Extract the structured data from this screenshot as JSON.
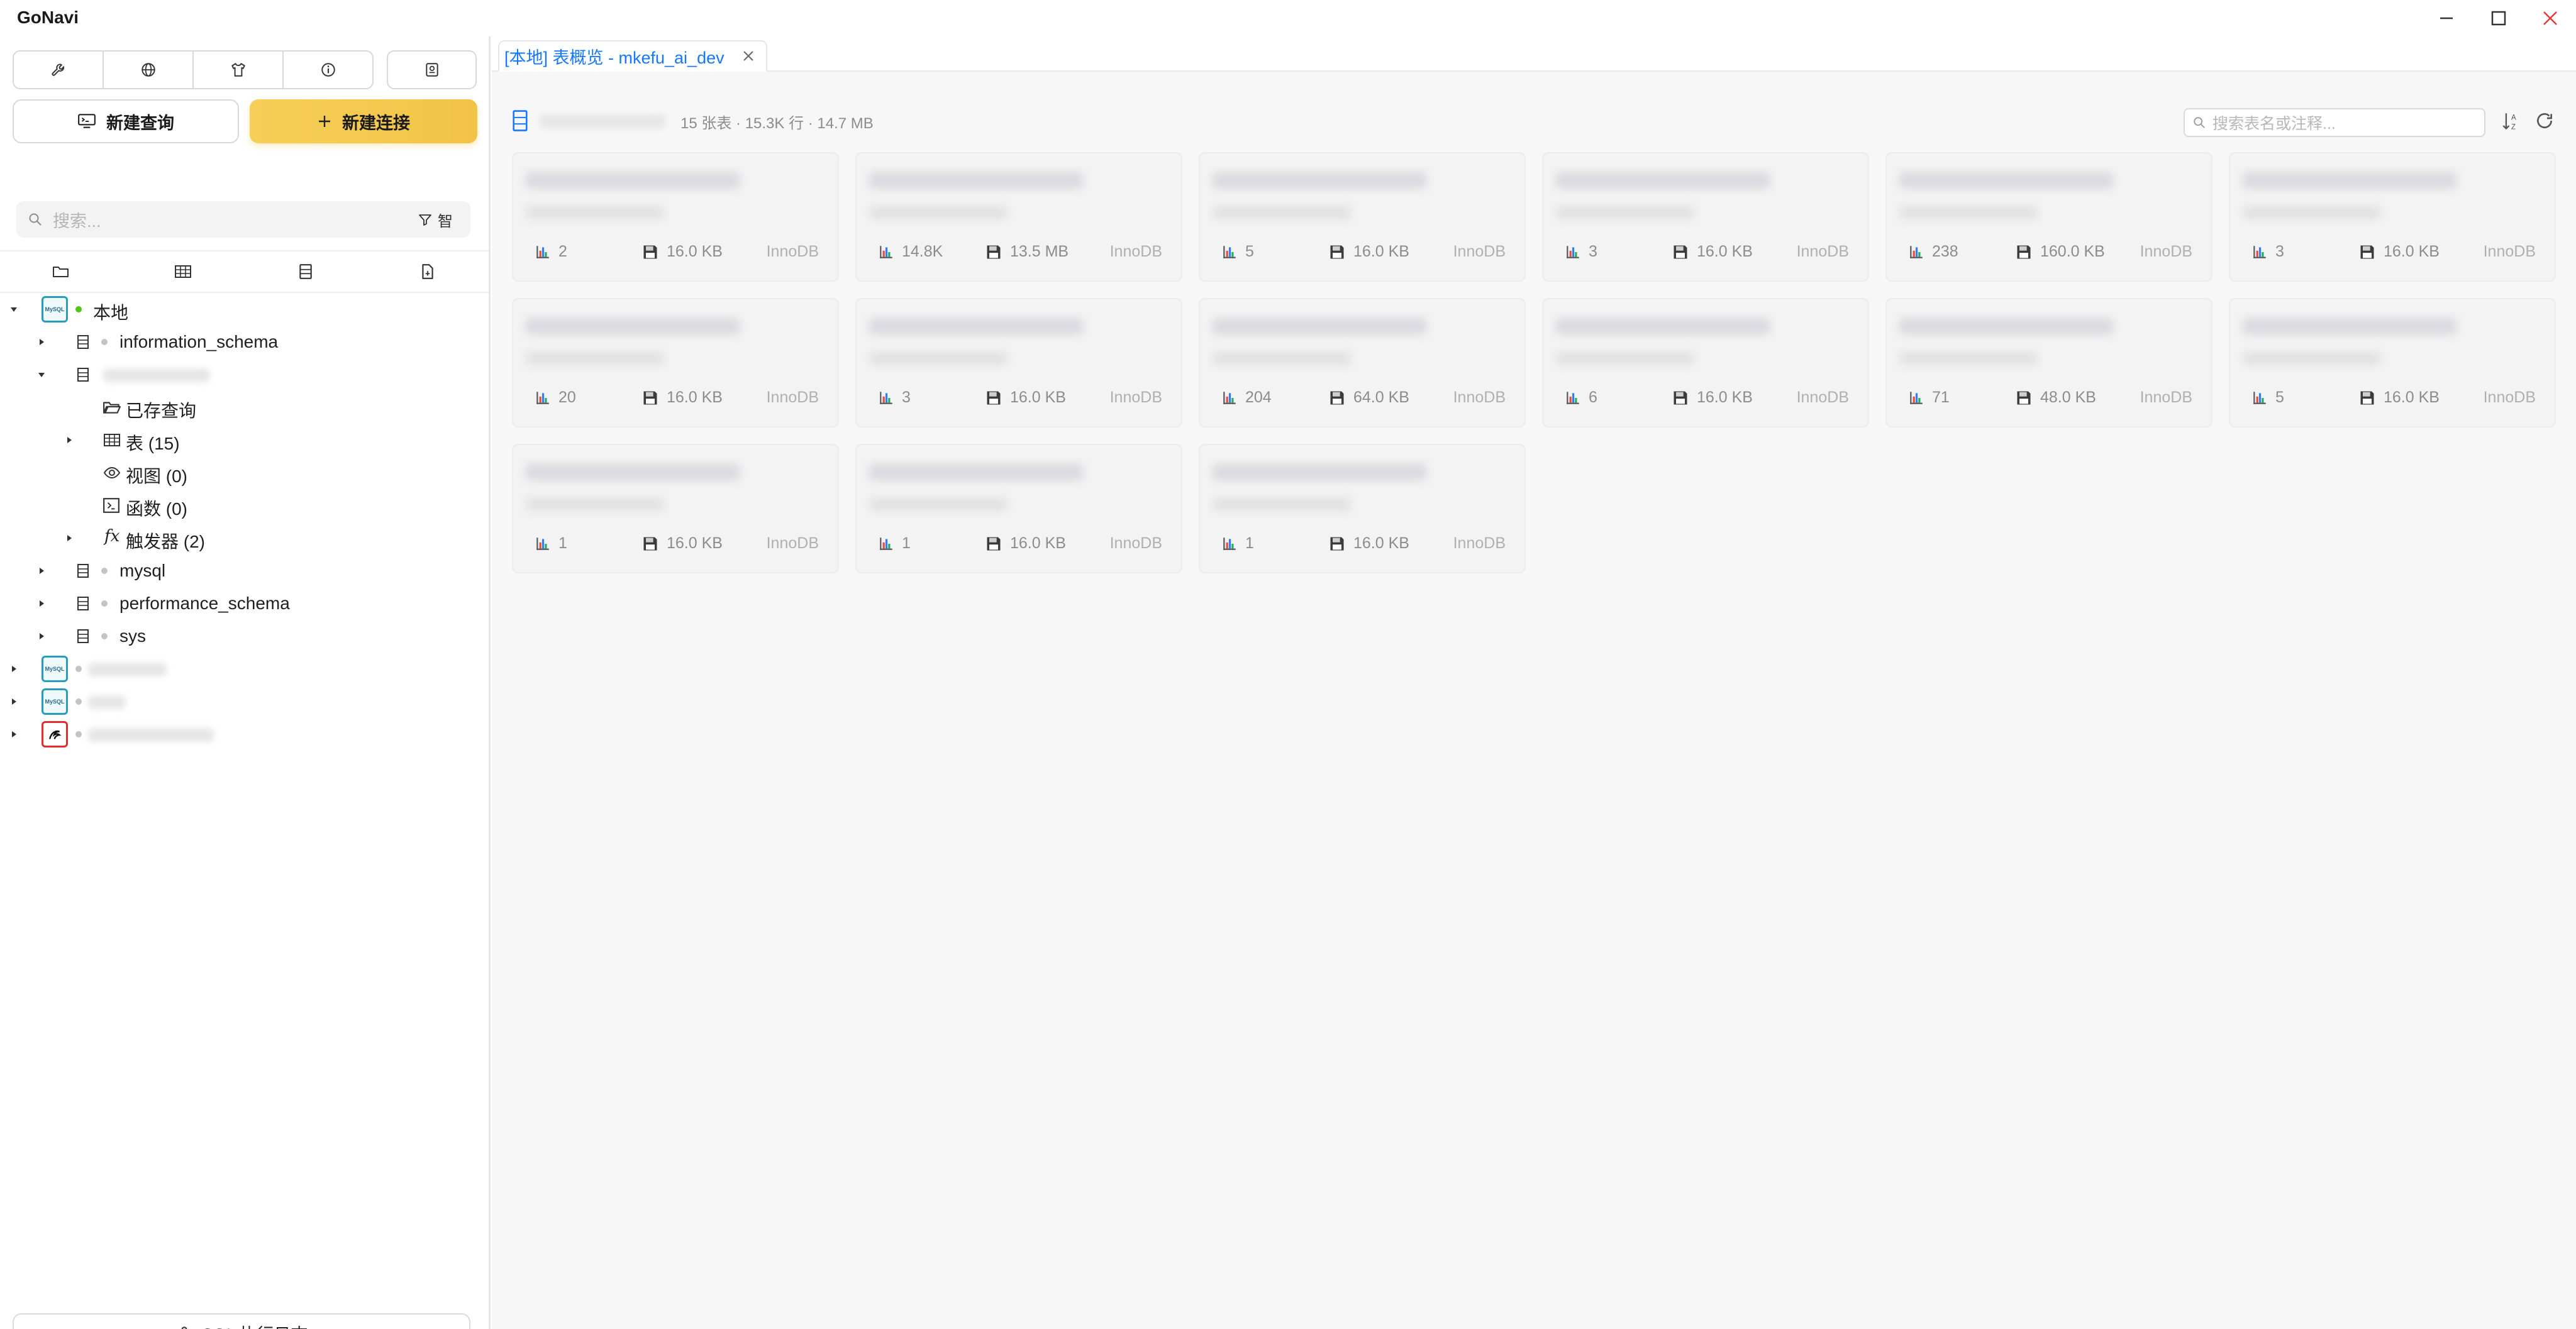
{
  "window": {
    "title": "GoNavi"
  },
  "sidebar": {
    "toolbar_icons": [
      "wrench-icon",
      "globe-icon",
      "shirt-icon",
      "info-icon",
      "contact-icon"
    ],
    "new_query_label": "新建查询",
    "new_connection_label": "新建连接",
    "search_placeholder": "搜索...",
    "filter_label": "智",
    "tab_icons": [
      "folder-icon",
      "table-icon",
      "database-icon",
      "file-icon"
    ],
    "tree": {
      "local_label": "本地",
      "db_information_schema": "information_schema",
      "saved_queries": "已存查询",
      "tables": "表 (15)",
      "views": "视图 (0)",
      "functions": "函数 (0)",
      "triggers": "触发器 (2)",
      "db_mysql": "mysql",
      "db_performance_schema": "performance_schema",
      "db_sys": "sys"
    },
    "sql_log_label": "SQL 执行日志"
  },
  "tab": {
    "label": "[本地] 表概览 - mkefu_ai_dev"
  },
  "overview": {
    "stats": "15 张表 · 15.3K 行 · 14.7 MB",
    "search_placeholder": "搜索表名或注释...",
    "cards": [
      {
        "rows": "2",
        "size": "16.0 KB",
        "engine": "InnoDB"
      },
      {
        "rows": "14.8K",
        "size": "13.5 MB",
        "engine": "InnoDB"
      },
      {
        "rows": "5",
        "size": "16.0 KB",
        "engine": "InnoDB"
      },
      {
        "rows": "3",
        "size": "16.0 KB",
        "engine": "InnoDB"
      },
      {
        "rows": "238",
        "size": "160.0 KB",
        "engine": "InnoDB"
      },
      {
        "rows": "3",
        "size": "16.0 KB",
        "engine": "InnoDB"
      },
      {
        "rows": "20",
        "size": "16.0 KB",
        "engine": "InnoDB"
      },
      {
        "rows": "3",
        "size": "16.0 KB",
        "engine": "InnoDB"
      },
      {
        "rows": "204",
        "size": "64.0 KB",
        "engine": "InnoDB"
      },
      {
        "rows": "6",
        "size": "16.0 KB",
        "engine": "InnoDB"
      },
      {
        "rows": "71",
        "size": "48.0 KB",
        "engine": "InnoDB"
      },
      {
        "rows": "5",
        "size": "16.0 KB",
        "engine": "InnoDB"
      },
      {
        "rows": "1",
        "size": "16.0 KB",
        "engine": "InnoDB"
      },
      {
        "rows": "1",
        "size": "16.0 KB",
        "engine": "InnoDB"
      },
      {
        "rows": "1",
        "size": "16.0 KB",
        "engine": "InnoDB"
      }
    ]
  },
  "colors": {
    "accent": "#1677ff",
    "primary_button": "#f3c84c",
    "connected": "#52c41a",
    "close_red": "#e53935"
  }
}
